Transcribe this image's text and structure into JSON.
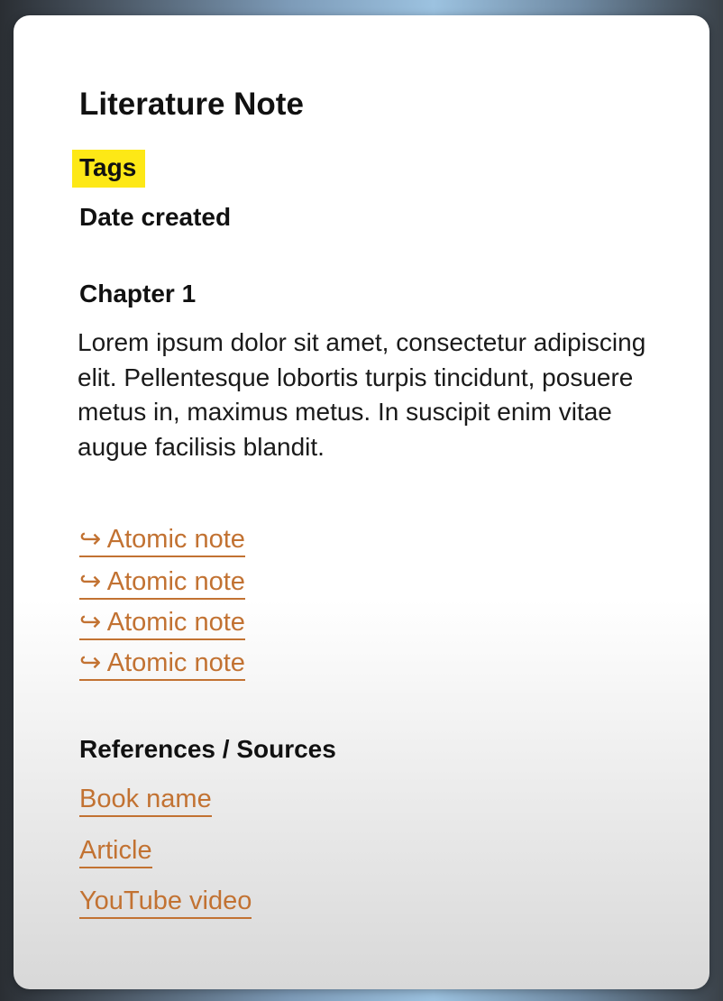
{
  "note": {
    "title": "Literature Note",
    "tags_label": "Tags",
    "date_label": "Date created",
    "chapter_heading": "Chapter 1",
    "paragraph": "Lorem ipsum dolor sit amet, consectetur adipiscing elit. Pellentesque lobortis turpis tincidunt, posuere metus in, maximus metus. In suscipit enim vitae augue facilisis blandit.",
    "atomic_links": [
      {
        "icon": "↪",
        "label": "Atomic note"
      },
      {
        "icon": "↪",
        "label": "Atomic note"
      },
      {
        "icon": "↪",
        "label": "Atomic note"
      },
      {
        "icon": "↪",
        "label": "Atomic note"
      }
    ],
    "references_heading": "References / Sources",
    "references": [
      "Book name",
      "Article",
      "YouTube video"
    ]
  },
  "colors": {
    "link": "#c27232",
    "highlight": "#fde816"
  }
}
